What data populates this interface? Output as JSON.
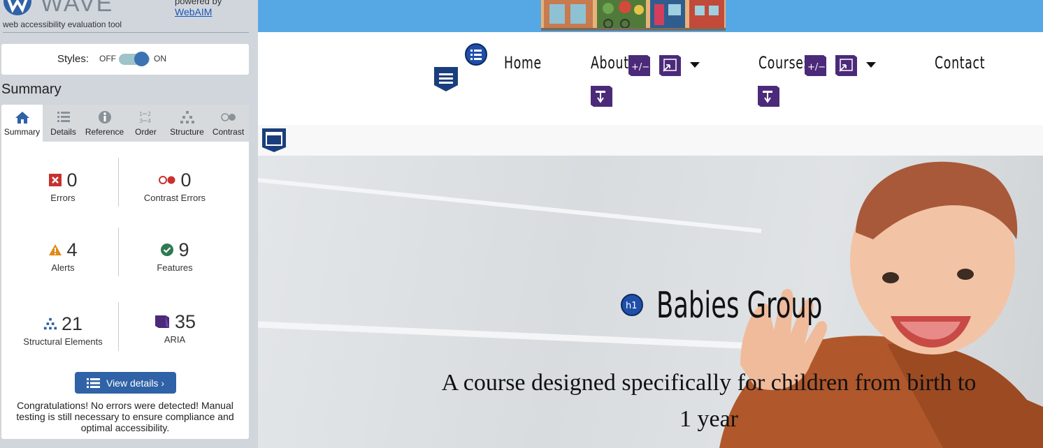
{
  "wave": {
    "logo_word": "WAVE",
    "tagline": "web accessibility evaluation tool",
    "powered_by": "powered by",
    "webaim_link": "WebAIM",
    "styles_label": "Styles:",
    "toggle_off": "OFF",
    "toggle_on": "ON",
    "summary_title": "Summary",
    "tabs": [
      {
        "label": "Summary",
        "icon": "home-icon",
        "active": true
      },
      {
        "label": "Details",
        "icon": "list-icon"
      },
      {
        "label": "Reference",
        "icon": "info-icon"
      },
      {
        "label": "Order",
        "icon": "order-icon"
      },
      {
        "label": "Structure",
        "icon": "structure-icon"
      },
      {
        "label": "Contrast",
        "icon": "contrast-icon"
      }
    ],
    "stats": {
      "errors": {
        "value": "0",
        "label": "Errors",
        "icon": "error-icon",
        "color": "#c8312e"
      },
      "contrast_errors": {
        "value": "0",
        "label": "Contrast Errors",
        "icon": "contrast-error-icon",
        "color": "#c8312e"
      },
      "alerts": {
        "value": "4",
        "label": "Alerts",
        "icon": "alert-icon",
        "color": "#e08b16"
      },
      "features": {
        "value": "9",
        "label": "Features",
        "icon": "feature-icon",
        "color": "#2e7a52"
      },
      "structural": {
        "value": "21",
        "label": "Structural Elements",
        "icon": "structure-icon",
        "color": "#2a5fa3"
      },
      "aria": {
        "value": "35",
        "label": "ARIA",
        "icon": "aria-icon",
        "color": "#4b2a7a"
      }
    },
    "view_details": "View details ›",
    "congrats": "Congratulations! No errors were detected! Manual testing is still necessary to ensure compliance and optimal accessibility."
  },
  "site": {
    "nav": {
      "home": "Home",
      "about": "About",
      "courses": "Courses",
      "contact": "Contact"
    },
    "hero": {
      "heading_badge": "h1",
      "title": "Babies Group",
      "subtitle": "A course designed specifically for children from birth to 1 year"
    }
  },
  "colors": {
    "wave_sidebar": "#d1d6dc",
    "wave_accent": "#2f62a6",
    "aria_purple": "#4b2a7a",
    "banner_blue": "#56a8e4"
  }
}
